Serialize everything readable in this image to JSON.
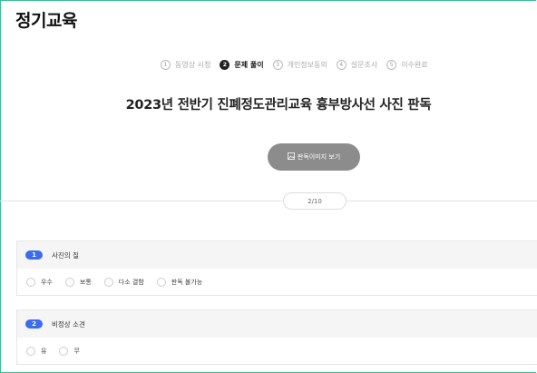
{
  "page": {
    "title": "정기교육"
  },
  "steps": [
    {
      "num": "1",
      "label": "동영상 시청",
      "active": false
    },
    {
      "num": "2",
      "label": "문제 풀이",
      "active": true
    },
    {
      "num": "3",
      "label": "개인정보동의",
      "active": false
    },
    {
      "num": "4",
      "label": "설문조사",
      "active": false
    },
    {
      "num": "5",
      "label": "이수완료",
      "active": false
    }
  ],
  "exam": {
    "title": "2023년 전반기 진폐정도관리교육 흉부방사선 사진 판독"
  },
  "view_button": {
    "label": "판독이미지 보기",
    "icon": "image-icon"
  },
  "pager": {
    "text": "2/10"
  },
  "questions": [
    {
      "num": "1",
      "label": "사진의 질",
      "options": [
        "우수",
        "보통",
        "다소 결함",
        "판독 불가능"
      ]
    },
    {
      "num": "2",
      "label": "비정상 소견",
      "options": [
        "유",
        "무"
      ]
    }
  ],
  "colors": {
    "accent": "#3b6cf0",
    "button": "#8c8c8c",
    "frame": "#39c08f"
  }
}
